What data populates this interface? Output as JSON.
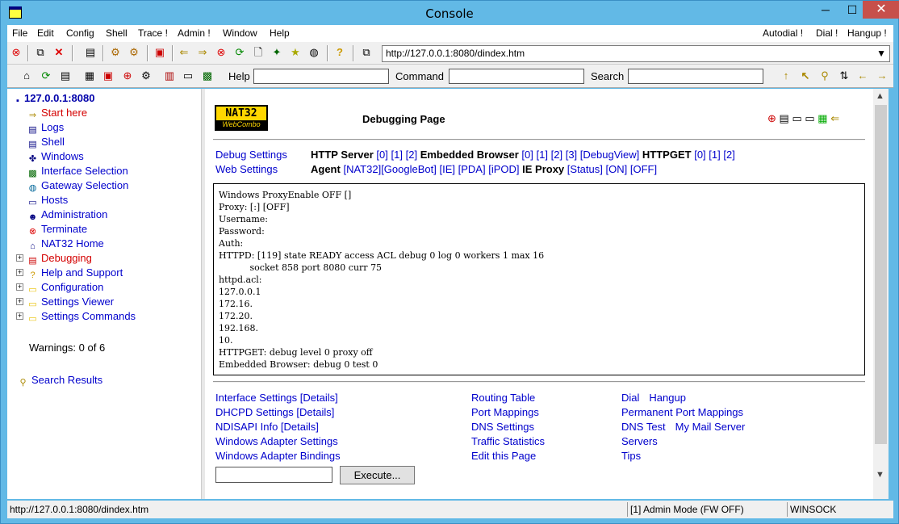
{
  "window": {
    "title": "Console",
    "min": "─",
    "max": "☐",
    "close": "✕"
  },
  "menu": {
    "items": [
      "File",
      "Edit",
      "Config",
      "Shell",
      "Trace !",
      "Admin !",
      "Window",
      "Help"
    ],
    "right": [
      "Autodial !",
      "Dial !",
      "Hangup !"
    ]
  },
  "address": {
    "url": "http://127.0.0.1:8080/dindex.htm"
  },
  "toolbar2": {
    "help_label": "Help",
    "command_label": "Command",
    "search_label": "Search"
  },
  "tree": {
    "root": "127.0.0.1:8080",
    "items": [
      {
        "label": "Start here",
        "icon": "arrow-right-icon",
        "color": "#d40000"
      },
      {
        "label": "Logs",
        "icon": "window-icon"
      },
      {
        "label": "Shell",
        "icon": "window-icon"
      },
      {
        "label": "Windows",
        "icon": "windows-icon"
      },
      {
        "label": "Interface Selection",
        "icon": "nic-icon"
      },
      {
        "label": "Gateway Selection",
        "icon": "globe-icon"
      },
      {
        "label": "Hosts",
        "icon": "computer-icon"
      },
      {
        "label": "Administration",
        "icon": "admin-icon"
      },
      {
        "label": "Terminate",
        "icon": "stop-icon"
      },
      {
        "label": "NAT32 Home",
        "icon": "home-icon"
      },
      {
        "label": "Debugging",
        "icon": "debug-icon",
        "color": "#d40000"
      },
      {
        "label": "Help and Support",
        "icon": "help-icon"
      },
      {
        "label": "Configuration",
        "icon": "folder-icon"
      },
      {
        "label": "Settings Viewer",
        "icon": "folder-icon"
      },
      {
        "label": "Settings Commands",
        "icon": "folder-icon"
      }
    ],
    "warnings": "Warnings: 0 of 6",
    "search_results": "Search Results"
  },
  "page": {
    "logo_top": "NAT32",
    "logo_bottom": "WebCombo",
    "title": "Debugging Page",
    "debug_settings": "Debug Settings",
    "web_settings": "Web Settings",
    "http_server": "HTTP Server",
    "http_server_links": [
      "[0]",
      "[1]",
      "[2]"
    ],
    "embedded_browser": "Embedded Browser",
    "embedded_links": [
      "[0]",
      "[1]",
      "[2]",
      "[3]",
      "[DebugView]"
    ],
    "httpget": "HTTPGET",
    "httpget_links": [
      "[0]",
      "[1]",
      "[2]"
    ],
    "agent": "Agent",
    "agent_links": [
      "[NAT32]",
      "[GoogleBot]",
      "[IE]",
      "[PDA]",
      "[iPOD]"
    ],
    "ie_proxy": "IE Proxy",
    "ie_proxy_links": [
      "[Status]",
      "[ON]",
      "[OFF]"
    ],
    "console_text": "Windows ProxyEnable OFF []\nProxy: [:] [OFF]\nUsername:\nPassword:\nAuth:\nHTTPD: [119] state READY access ACL debug 0 log 0 workers 1 max 16\n           socket 858 port 8080 curr 75\nhttpd.acl:\n127.0.0.1\n172.16.\n172.20.\n192.168.\n10.\nHTTPGET: debug level 0 proxy off\nEmbedded Browser: debug 0 test 0",
    "links_col1": [
      "Interface Settings [Details]",
      "DHCPD Settings [Details]",
      "NDISAPI Info [Details]",
      "Windows Adapter Settings",
      "Windows Adapter Bindings"
    ],
    "links_col2": [
      "Routing Table",
      "Port Mappings",
      "DNS Settings",
      "Traffic Statistics",
      "Edit this Page"
    ],
    "links_col3": [
      [
        "Dial",
        "Hangup"
      ],
      [
        "Permanent Port Mappings"
      ],
      [
        "DNS Test",
        "My Mail Server"
      ],
      [
        "Servers"
      ],
      [
        "Tips"
      ]
    ],
    "execute": "Execute..."
  },
  "status": {
    "url": "http://127.0.0.1:8080/dindex.htm",
    "mode": "[1] Admin Mode (FW OFF)",
    "net": "WINSOCK"
  }
}
